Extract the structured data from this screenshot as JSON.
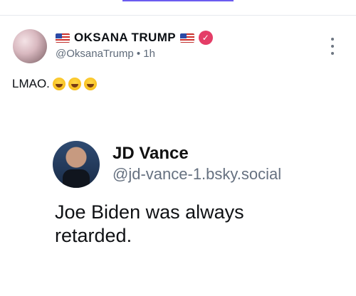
{
  "post": {
    "display_name": "OKSANA TRUMP",
    "flag_left": "US flag",
    "flag_right": "US flag",
    "handle": "@OksanaTrump",
    "time": "1h",
    "text": "LMAO.",
    "emojis": [
      "joy-emoji",
      "joy-emoji",
      "joy-emoji"
    ],
    "verified_color": "#e43d67"
  },
  "quoted": {
    "name": "JD Vance",
    "handle": "@jd-vance-1.bsky.social",
    "text": "Joe Biden was always retarded."
  }
}
